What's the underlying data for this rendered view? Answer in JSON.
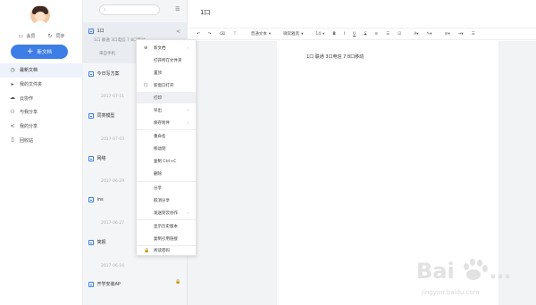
{
  "sidebar": {
    "actions": [
      {
        "icon": "monitor-icon",
        "label": "会员"
      },
      {
        "icon": "sync-icon",
        "label": "同步"
      }
    ],
    "new_button": {
      "label": "新文档"
    },
    "nav": [
      {
        "icon": "clock-icon",
        "label": "最新文档",
        "active": true
      },
      {
        "icon": "folder-icon",
        "label": "我的文件夹"
      },
      {
        "icon": "group-icon",
        "label": "云协作"
      },
      {
        "icon": "users-icon",
        "label": "与我分享"
      },
      {
        "icon": "share-icon",
        "label": "我的分享"
      },
      {
        "icon": "trash-icon",
        "label": "回收站"
      }
    ]
  },
  "list": {
    "search_icon": "search-icon",
    "docs": [
      {
        "title": "1口",
        "sub1": "1口 联通 3口电信 7 8口移动",
        "sub2": "来自手机",
        "date": ""
      },
      {
        "title": "今日写方案",
        "date": "2017-07-11"
      },
      {
        "title": "同类模型",
        "date": "2017-07-03"
      },
      {
        "title": "网络",
        "date": "2017-06-29"
      },
      {
        "title": "ins",
        "date": "2017-06-27"
      },
      {
        "title": "简报",
        "date": "2017-06-16"
      },
      {
        "title": "开学安装AP",
        "date": ""
      }
    ]
  },
  "context_menu": {
    "items": [
      {
        "label": "新文档",
        "lead": "⊕",
        "arrow": true
      },
      {
        "label": "打开所在文件夹"
      },
      {
        "label": "置顶"
      },
      {
        "label": "新窗口打开",
        "lead": "☐"
      },
      {
        "label": "打印",
        "highlight": true
      },
      {
        "label": "导出",
        "arrow": true
      },
      {
        "label": "保存附件",
        "arrow": true
      },
      {
        "label": "重命名"
      },
      {
        "label": "移动到"
      },
      {
        "label": "复制 Ctrl+C"
      },
      {
        "label": "删除"
      },
      {
        "label": "分享"
      },
      {
        "label": "取消分享"
      },
      {
        "label": "发送到云协作",
        "arrow": true
      },
      {
        "label": "显示历史版本"
      },
      {
        "label": "复制引用链接"
      },
      {
        "label": "阅读密码",
        "lead": "🔒"
      }
    ]
  },
  "editor": {
    "title": "1口",
    "content": "1口 联通 3口电信 7 8口移动",
    "toolbar": {
      "style": "普通文本",
      "font": "微软雅黑",
      "size": "14",
      "bold": "B",
      "italic": "I",
      "underline": "U",
      "strike": "S"
    }
  },
  "watermark": {
    "text": "Bai",
    "url": "jingyan.baidu.com"
  }
}
